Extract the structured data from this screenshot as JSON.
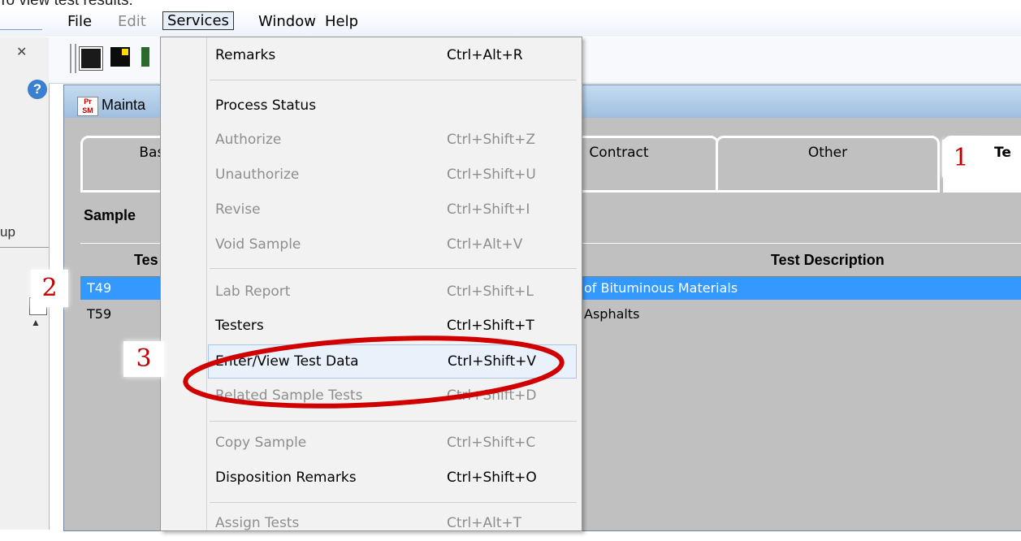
{
  "caption": "To view test results:",
  "menubar": {
    "items": [
      "File",
      "Edit",
      "Services",
      "Window",
      "Help"
    ]
  },
  "left_panel": {
    "close_glyph": "✕",
    "help_glyph": "?",
    "label_fragment": "up"
  },
  "window": {
    "title_fragment": "Mainta"
  },
  "tabs": [
    {
      "label": "Basic S"
    },
    {
      "label": "Contract"
    },
    {
      "label": "Other"
    },
    {
      "label": "Te"
    }
  ],
  "section_label": "Sample",
  "grid": {
    "headers": [
      "Tes",
      "Test Description"
    ],
    "rows": [
      {
        "code": "T49",
        "description": "of Bituminous Materials",
        "selected": true
      },
      {
        "code": "T59",
        "description": "Asphalts",
        "selected": false
      }
    ]
  },
  "services_menu": [
    {
      "label": "Remarks",
      "shortcut": "Ctrl+Alt+R",
      "enabled": true
    },
    {
      "label": "Process Status",
      "shortcut": "",
      "enabled": true
    },
    {
      "label": "Authorize",
      "shortcut": "Ctrl+Shift+Z",
      "enabled": false
    },
    {
      "label": "Unauthorize",
      "shortcut": "Ctrl+Shift+U",
      "enabled": false
    },
    {
      "label": "Revise",
      "shortcut": "Ctrl+Shift+I",
      "enabled": false
    },
    {
      "label": "Void Sample",
      "shortcut": "Ctrl+Alt+V",
      "enabled": false
    },
    {
      "label": "Lab Report",
      "shortcut": "Ctrl+Shift+L",
      "enabled": false
    },
    {
      "label": "Testers",
      "shortcut": "Ctrl+Shift+T",
      "enabled": true
    },
    {
      "label": "Enter/View Test Data",
      "shortcut": "Ctrl+Shift+V",
      "enabled": true,
      "highlighted": true
    },
    {
      "label": "Related Sample Tests",
      "shortcut": "Ctrl+Shift+D",
      "enabled": false
    },
    {
      "label": "Copy Sample",
      "shortcut": "Ctrl+Shift+C",
      "enabled": false
    },
    {
      "label": "Disposition Remarks",
      "shortcut": "Ctrl+Shift+O",
      "enabled": true
    },
    {
      "label": "Assign Tests",
      "shortcut": "Ctrl+Alt+T",
      "enabled": false
    }
  ],
  "callouts": [
    "1",
    "2",
    "3"
  ],
  "annotation_color": "#c00000",
  "selection_color": "#3399ff"
}
